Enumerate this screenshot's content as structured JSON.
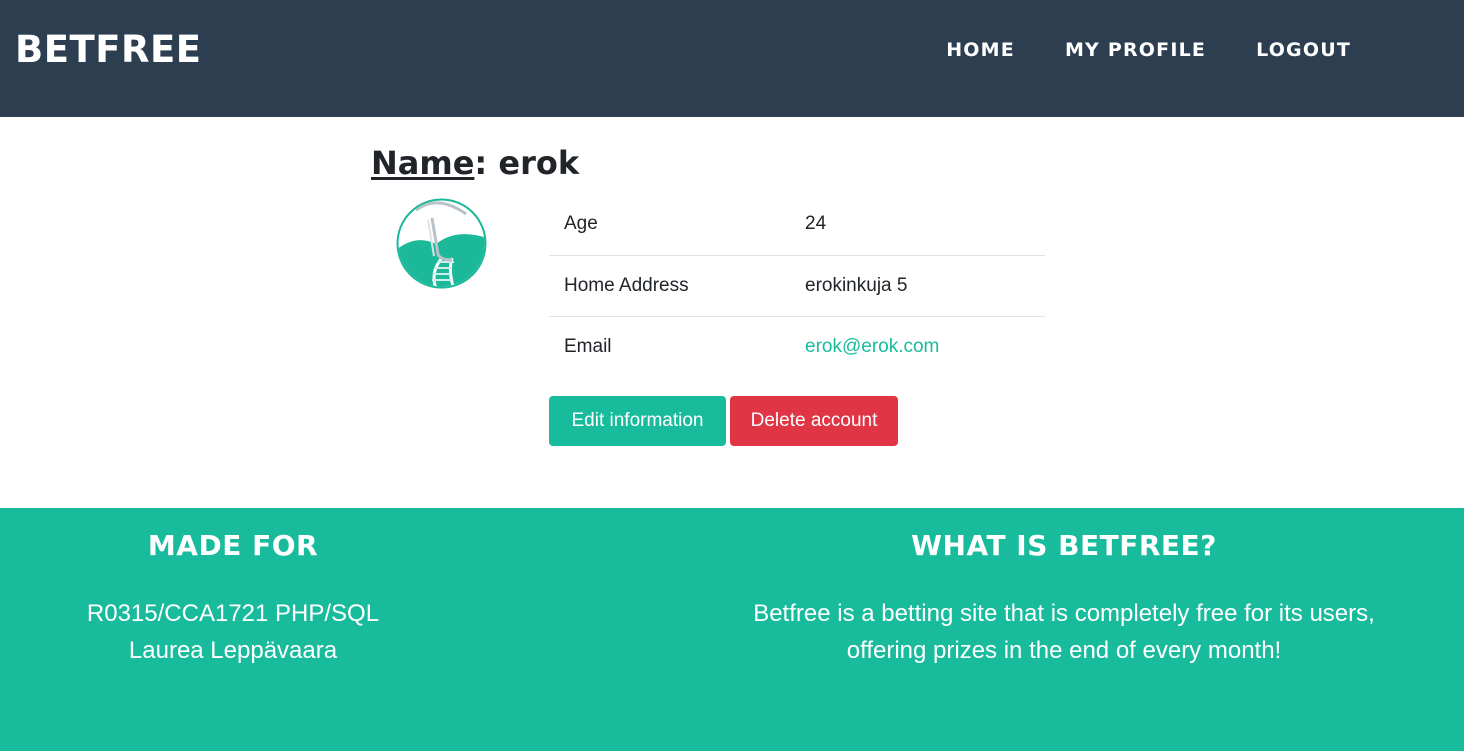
{
  "nav": {
    "brand": "BETFREE",
    "links": [
      "HOME",
      "MY PROFILE",
      "LOGOUT"
    ]
  },
  "profile": {
    "title_label": "Name",
    "title_sep": ":",
    "username": "erok",
    "avatar_icon": "railway-track-logo-icon",
    "rows": [
      {
        "key": "Age",
        "value": "24"
      },
      {
        "key": "Home Address",
        "value": "erokinkuja 5"
      },
      {
        "key": "Email",
        "value": "erok@erok.com"
      }
    ],
    "edit_button": "Edit information",
    "delete_button": "Delete account"
  },
  "footer": {
    "left_heading": "MADE FOR",
    "left_line1": "R0315/CCA1721 PHP/SQL",
    "left_line2": "Laurea Leppävaara",
    "right_heading": "WHAT IS BETFREE?",
    "right_line1": "Betfree is a betting site that is completely free for its users,",
    "right_line2": "offering prizes in the end of every month!"
  },
  "colors": {
    "navbar": "#2c3e50",
    "accent": "#18bc9c",
    "danger": "#e03545"
  }
}
